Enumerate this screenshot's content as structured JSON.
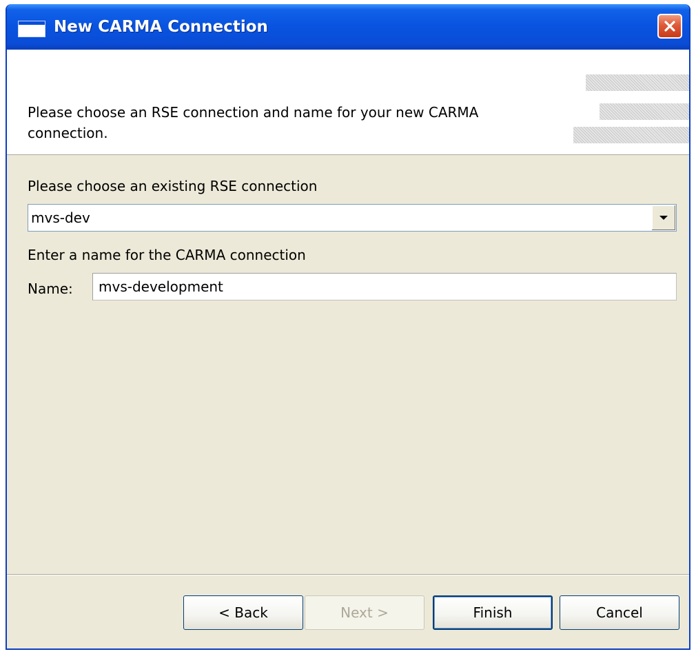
{
  "window": {
    "title": "New CARMA Connection"
  },
  "header": {
    "description": "Please choose an RSE connection and name for your new CARMA connection."
  },
  "form": {
    "rse_label": "Please choose an existing RSE connection",
    "rse_selected": "mvs-dev",
    "name_section_label": "Enter a name for the CARMA connection",
    "name_label": "Name:",
    "name_value": "mvs-development"
  },
  "buttons": {
    "back": "< Back",
    "next": "Next >",
    "finish": "Finish",
    "cancel": "Cancel"
  },
  "icons": {
    "window": "window-icon",
    "close": "close-icon",
    "dropdown": "chevron-down-icon"
  },
  "colors": {
    "titlebar": "#0853e0",
    "close_button": "#de5a38",
    "dialog_background": "#ece9d8"
  }
}
